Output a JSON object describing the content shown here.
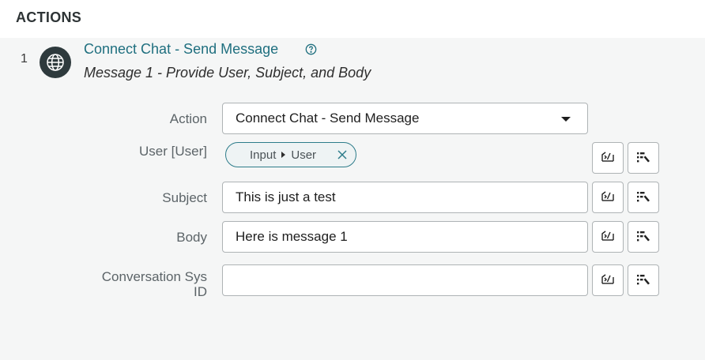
{
  "header": {
    "title": "ACTIONS"
  },
  "action": {
    "number": "1",
    "title": "Connect Chat - Send Message",
    "subtitle": "Message 1 - Provide User, Subject, and Body"
  },
  "form": {
    "action_label": "Action",
    "action_value": "Connect Chat - Send Message",
    "user_label": "User [User]",
    "user_pill": {
      "part1": "Input",
      "part2": "User"
    },
    "subject_label": "Subject",
    "subject_value": "This is just a test",
    "body_label": "Body",
    "body_value": "Here is message 1",
    "conversation_label_line1": "Conversation Sys",
    "conversation_label_line2": "ID",
    "conversation_value": ""
  },
  "icons": {
    "action": "globe-icon",
    "help": "help-circle-icon",
    "script_toggle": "script-toggle-icon",
    "data_picker": "data-pill-picker-icon",
    "remove": "close-icon"
  },
  "colors": {
    "accent": "#1f6f7f",
    "pill_border": "#2d7c8a",
    "panel_bg": "#f5f6f6",
    "globe_bg": "#2e3a3d"
  }
}
